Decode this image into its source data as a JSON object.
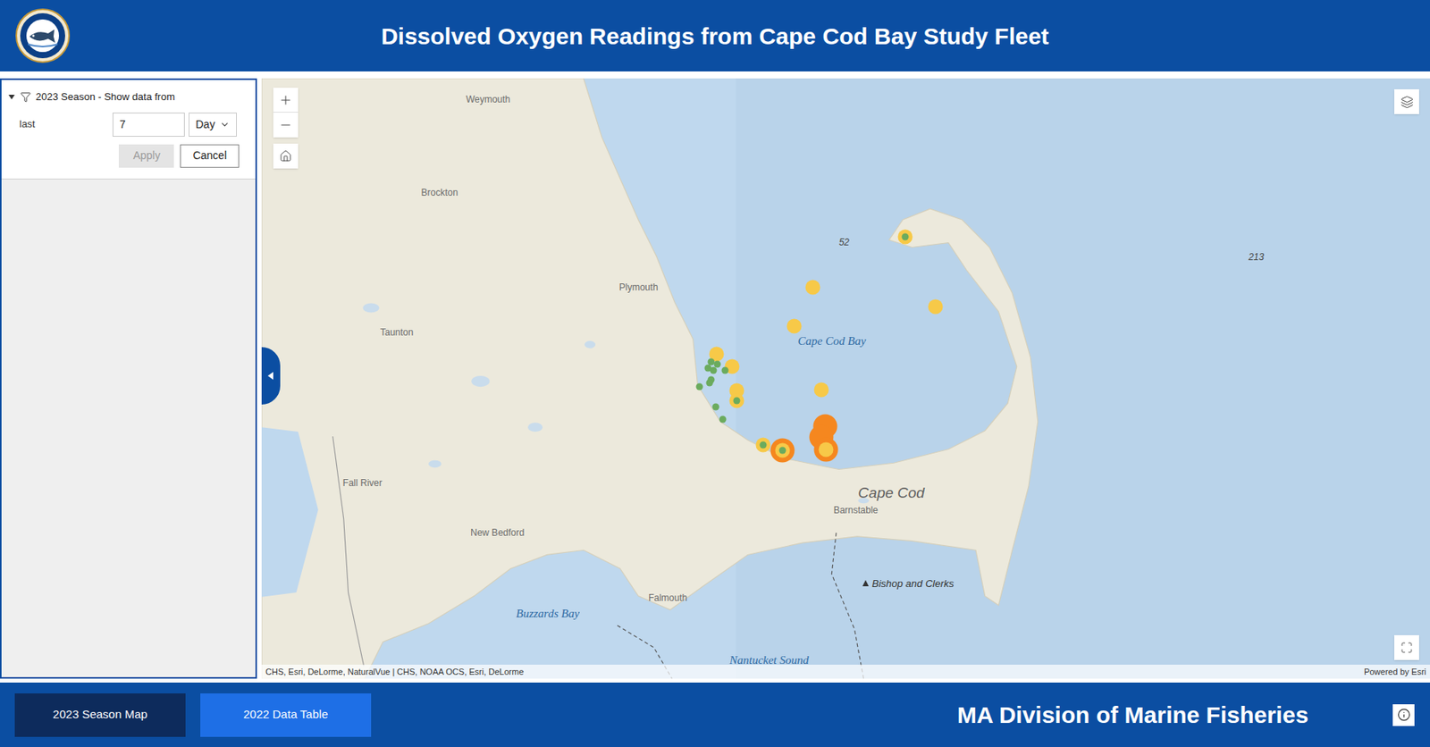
{
  "header": {
    "title": "Dissolved Oxygen Readings from Cape Cod Bay Study Fleet"
  },
  "filter": {
    "expanded": true,
    "title": "2023 Season - Show data from",
    "label": "last",
    "value": "7",
    "unit": "Day",
    "buttons": [
      {
        "label": "Apply",
        "disabled": true
      },
      {
        "label": "Cancel",
        "disabled": false
      }
    ]
  },
  "map": {
    "labels": [
      {
        "text": "Weymouth",
        "kind": "place"
      },
      {
        "text": "Brockton",
        "kind": "place"
      },
      {
        "text": "Plymouth",
        "kind": "place"
      },
      {
        "text": "Taunton",
        "kind": "place"
      },
      {
        "text": "Fall River",
        "kind": "place"
      },
      {
        "text": "New Bedford",
        "kind": "place"
      },
      {
        "text": "Buzzards Bay",
        "kind": "water"
      },
      {
        "text": "Falmouth",
        "kind": "place"
      },
      {
        "text": "Cape Cod Bay",
        "kind": "water"
      },
      {
        "text": "Cape Cod",
        "kind": "region"
      },
      {
        "text": "Barnstable",
        "kind": "place"
      },
      {
        "text": "Bishop and Clerks",
        "kind": "feature"
      },
      {
        "text": "52",
        "kind": "depth"
      },
      {
        "text": "213",
        "kind": "depth"
      },
      {
        "text": "Nantucket Sound",
        "kind": "water"
      }
    ],
    "markers": [
      {
        "kind": "large",
        "color": "#f5871f"
      },
      {
        "kind": "large",
        "color": "#f5871f"
      },
      {
        "kind": "large",
        "color": "#f5871f"
      },
      {
        "kind": "large",
        "color": "#f5871f"
      },
      {
        "kind": "medium",
        "color": "#f7c948"
      },
      {
        "kind": "medium",
        "color": "#f7c948"
      },
      {
        "kind": "medium",
        "color": "#f7c948"
      },
      {
        "kind": "medium",
        "color": "#f7c948"
      },
      {
        "kind": "medium",
        "color": "#f7c948"
      },
      {
        "kind": "medium",
        "color": "#f7c948"
      },
      {
        "kind": "medium",
        "color": "#f7c948"
      },
      {
        "kind": "medium",
        "color": "#f7c948"
      },
      {
        "kind": "medium",
        "color": "#f7c948"
      },
      {
        "kind": "medium",
        "color": "#f7c948"
      },
      {
        "kind": "medium",
        "color": "#f7c948"
      },
      {
        "kind": "medium",
        "color": "#f7c948"
      },
      {
        "kind": "small",
        "color": "#6bab5e"
      },
      {
        "kind": "small",
        "color": "#6bab5e"
      },
      {
        "kind": "small",
        "color": "#6bab5e"
      },
      {
        "kind": "small",
        "color": "#6bab5e"
      },
      {
        "kind": "small",
        "color": "#6bab5e"
      },
      {
        "kind": "small",
        "color": "#6bab5e"
      },
      {
        "kind": "small",
        "color": "#6bab5e"
      },
      {
        "kind": "small",
        "color": "#6bab5e"
      },
      {
        "kind": "small",
        "color": "#6bab5e"
      },
      {
        "kind": "small",
        "color": "#6bab5e"
      },
      {
        "kind": "small",
        "color": "#6bab5e"
      },
      {
        "kind": "small",
        "color": "#6bab5e"
      },
      {
        "kind": "small",
        "color": "#6bab5e"
      },
      {
        "kind": "small",
        "color": "#6bab5e"
      }
    ],
    "attribution": "CHS, Esri, DeLorme, NaturalVue | CHS, NOAA OCS, Esri, DeLorme",
    "powered_by": "Powered by Esri"
  },
  "footer": {
    "tabs": [
      {
        "label": "2023 Season Map",
        "selected": true
      },
      {
        "label": "2022 Data Table",
        "selected": false
      }
    ],
    "agency": "MA Division of Marine Fisheries"
  }
}
